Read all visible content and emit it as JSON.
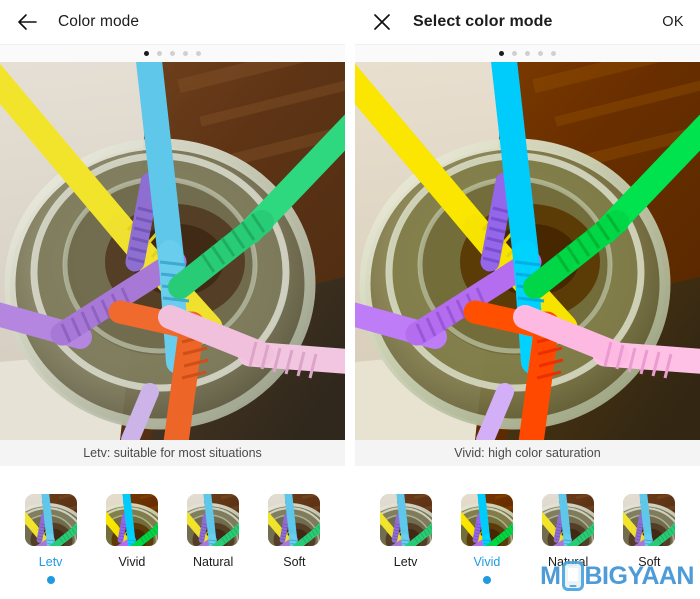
{
  "left_panel": {
    "appbar": {
      "back_icon": "arrow-left-icon",
      "title": "Color mode"
    },
    "pager": {
      "total": 5,
      "active_index": 0
    },
    "caption": "Letv: suitable for most situations",
    "modes": [
      {
        "label": "Letv",
        "selected": true
      },
      {
        "label": "Vivid",
        "selected": false
      },
      {
        "label": "Natural",
        "selected": false
      },
      {
        "label": "Soft",
        "selected": false
      }
    ]
  },
  "right_panel": {
    "appbar": {
      "close_icon": "close-icon",
      "title": "Select color mode",
      "confirm_label": "OK"
    },
    "pager": {
      "total": 5,
      "active_index": 0
    },
    "caption": "Vivid: high color saturation",
    "modes": [
      {
        "label": "Letv",
        "selected": false
      },
      {
        "label": "Vivid",
        "selected": true
      },
      {
        "label": "Natural",
        "selected": false
      },
      {
        "label": "Soft",
        "selected": false
      }
    ]
  },
  "watermark": {
    "text_before": "M",
    "text_after": "BIGYAAN"
  },
  "colors": {
    "accent": "#1e9be0",
    "text_primary": "#1c1c1c",
    "caption_bg": "#f4f4f4",
    "dot_active": "#1b1b1b",
    "dot_inactive": "#d0d0d0"
  }
}
